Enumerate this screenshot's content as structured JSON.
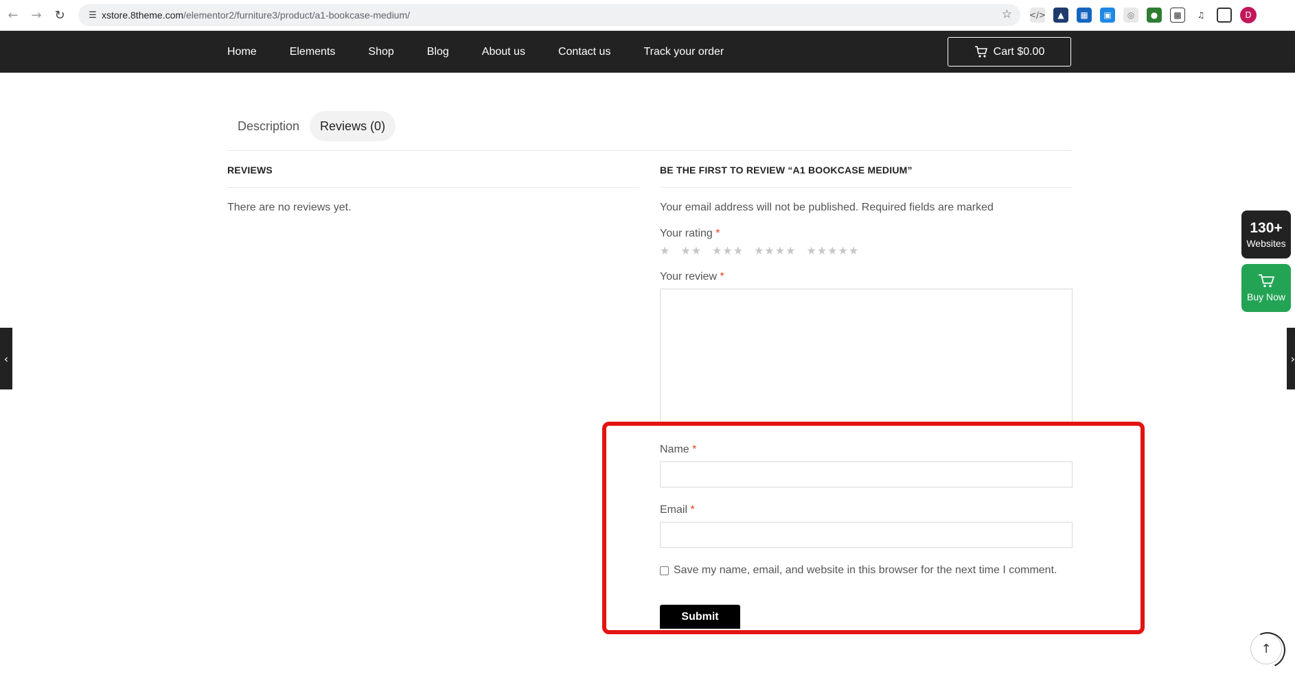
{
  "browser": {
    "url_host": "xstore.8theme.com",
    "url_path": "/elementor2/furniture3/product/a1-bookcase-medium/",
    "profile_initial": "D",
    "icons": [
      "back-icon",
      "forward-icon",
      "reload-icon",
      "site-info-icon",
      "bookmark-star-icon",
      "extensions-icon",
      "side-panel-icon"
    ]
  },
  "header": {
    "menu": [
      "Home",
      "Elements",
      "Shop",
      "Blog",
      "About us",
      "Contact us",
      "Track your order"
    ],
    "cart_label": "Cart $0.00"
  },
  "tabs": [
    {
      "label": "Description",
      "active": false
    },
    {
      "label": "Reviews (0)",
      "active": true
    }
  ],
  "reviews": {
    "title": "REVIEWS",
    "empty_text": "There are no reviews yet."
  },
  "form": {
    "title": "BE THE FIRST TO REVIEW “A1 BOOKCASE MEDIUM”",
    "note": "Your email address will not be published. Required fields are marked",
    "rating_label": "Your rating",
    "review_label": "Your review",
    "name_label": "Name",
    "email_label": "Email",
    "required_mark": "*",
    "save_info_label": "Save my name, email, and website in this browser for the next time I comment.",
    "submit_label": "Submit",
    "rating_options": [
      "1 star",
      "2 stars",
      "3 stars",
      "4 stars",
      "5 stars"
    ]
  },
  "widgets": {
    "websites_count": "130+",
    "websites_label": "Websites",
    "buy_label": "Buy Now"
  },
  "colors": {
    "header_bg": "#222222",
    "required": "#e2401c",
    "highlight": "#e3140f",
    "buy_green": "#23a455"
  }
}
